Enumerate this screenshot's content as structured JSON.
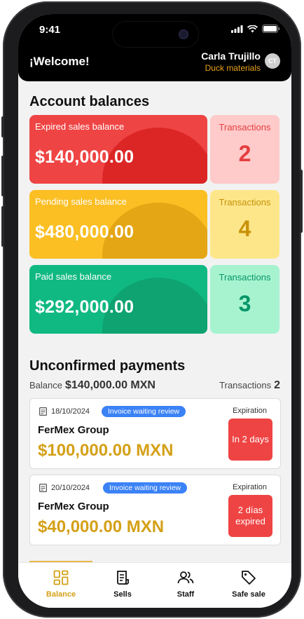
{
  "status_bar": {
    "time": "9:41"
  },
  "header": {
    "welcome": "¡Welcome!",
    "user_name": "Carla Trujillo",
    "company": "Duck materials",
    "avatar_initials": "CT"
  },
  "balances": {
    "title": "Account balances",
    "cards": [
      {
        "label": "Expired sales balance",
        "amount": "$140,000.00",
        "tx_label": "Transactions",
        "tx_count": "2",
        "color": "#ef4444",
        "circle_color": "#dc2626",
        "tx_bg": "#fecaca",
        "tx_color": "#e53e3e"
      },
      {
        "label": "Pending sales balance",
        "amount": "$480,000.00",
        "tx_label": "Transactions",
        "tx_count": "4",
        "color": "#fbbf24",
        "circle_color": "#e4a614",
        "tx_bg": "#fde68a",
        "tx_color": "#c89207"
      },
      {
        "label": "Paid sales balance",
        "amount": "$292,000.00",
        "tx_label": "Transactions",
        "tx_count": "3",
        "color": "#10b981",
        "circle_color": "#0ea371",
        "tx_bg": "#a7f3d0",
        "tx_color": "#059669"
      }
    ]
  },
  "unconfirmed": {
    "title": "Unconfirmed payments",
    "balance_label": "Balance",
    "balance_amount": "$140,000.00 MXN",
    "transactions_label": "Transactions",
    "transactions_count": "2",
    "payments": [
      {
        "date": "18/10/2024",
        "badge": "Invoice waiting review",
        "company": "FerMex Group",
        "amount": "$100,000.00 MXN",
        "expiration_label": "Expiration",
        "expiration": "In 2 days"
      },
      {
        "date": "20/10/2024",
        "badge": "Invoice waiting review",
        "company": "FerMex Group",
        "amount": "$40,000.00 MXN",
        "expiration_label": "Expiration",
        "expiration": "2 días expired"
      }
    ]
  },
  "tabbar": {
    "tabs": [
      {
        "label": "Balance",
        "icon": "grid-icon",
        "active": true
      },
      {
        "label": "Sells",
        "icon": "receipt-icon",
        "active": false
      },
      {
        "label": "Staff",
        "icon": "users-icon",
        "active": false
      },
      {
        "label": "Safe sale",
        "icon": "tag-icon",
        "active": false
      }
    ]
  },
  "colors": {
    "accent": "#d4a017",
    "badge_blue": "#3b82f6",
    "expired_red": "#ef4444"
  }
}
